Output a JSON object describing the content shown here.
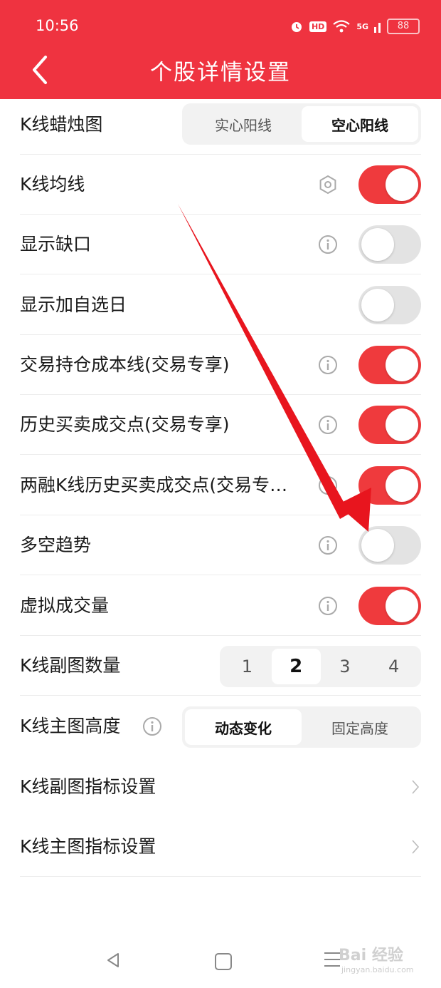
{
  "status_bar": {
    "time": "10:56",
    "hd": "HD",
    "signal": "5G",
    "battery": "88"
  },
  "header": {
    "title": "个股详情设置"
  },
  "rows": {
    "candle": {
      "label": "K线蜡烛图",
      "options": [
        "实心阳线",
        "空心阳线"
      ],
      "selected": "空心阳线"
    },
    "ma": {
      "label": "K线均线",
      "enabled": true
    },
    "gap": {
      "label": "显示缺口",
      "enabled": false
    },
    "add_watch": {
      "label": "显示加自选日",
      "enabled": false
    },
    "cost_line": {
      "label": "交易持仓成本线(交易专享)",
      "enabled": true
    },
    "history_trades": {
      "label": "历史买卖成交点(交易专享)",
      "enabled": true
    },
    "margin_trades": {
      "label": "两融K线历史买卖成交点(交易专…",
      "enabled": true
    },
    "trend": {
      "label": "多空趋势",
      "enabled": false
    },
    "virtual_volume": {
      "label": "虚拟成交量",
      "enabled": true
    },
    "sub_count": {
      "label": "K线副图数量",
      "options": [
        "1",
        "2",
        "3",
        "4"
      ],
      "selected": "2"
    },
    "main_height": {
      "label": "K线主图高度",
      "options": [
        "动态变化",
        "固定高度"
      ],
      "selected": "动态变化"
    },
    "sub_indicator": {
      "label": "K线副图指标设置"
    },
    "main_indicator": {
      "label": "K线主图指标设置"
    }
  },
  "watermark": {
    "text": "Bai 经验",
    "sub": "jingyan.baidu.com"
  },
  "colors": {
    "accent": "#ef3340",
    "toggle_on": "#ef3a3d",
    "toggle_off": "#e3e3e3"
  }
}
